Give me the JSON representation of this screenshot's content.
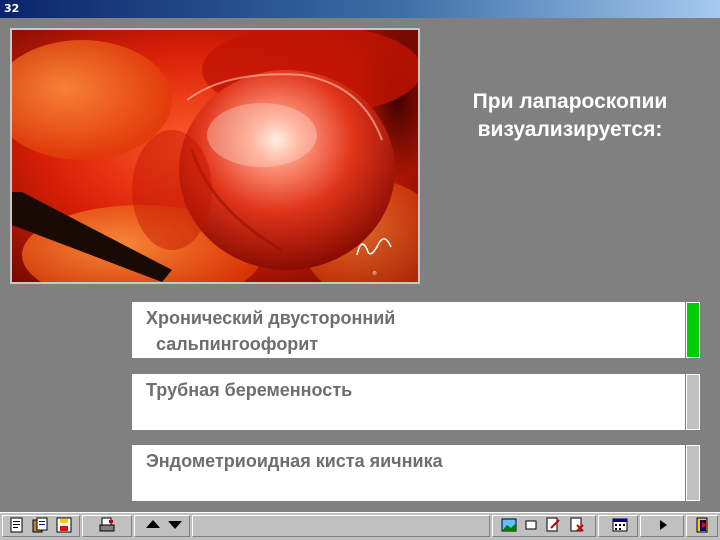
{
  "window": {
    "title": "32"
  },
  "question": {
    "line1": "При лапароскопии",
    "line2": "визуализируется:"
  },
  "photo": {
    "signature_icon": "surgeon-signature"
  },
  "answers": [
    {
      "text": "Хронический двусторонний\n  сальпингоофорит",
      "indicator_color": "#00cc00",
      "selected": true
    },
    {
      "text": "Трубная беременность",
      "indicator_color": "#c0c0c0",
      "selected": false
    },
    {
      "text": "Эндометриоидная киста яичника",
      "indicator_color": "#c0c0c0",
      "selected": false
    }
  ],
  "toolbar": {
    "icons": [
      "notes-icon",
      "clipboard-icon",
      "save-icon",
      "print-icon",
      "arrow-up-icon",
      "arrow-down-icon",
      "picture-icon",
      "window-icon",
      "edit-icon",
      "delete-icon",
      "calendar-icon",
      "play-icon",
      "exit-icon"
    ]
  }
}
